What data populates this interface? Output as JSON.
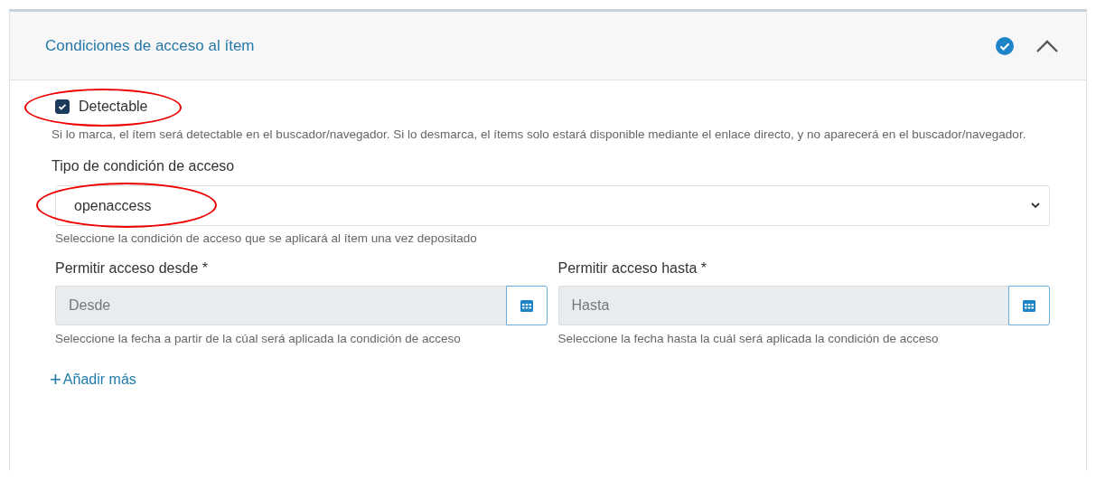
{
  "panel": {
    "title": "Condiciones de acceso al ítem",
    "completed": true,
    "expanded": true
  },
  "detectable": {
    "label": "Detectable",
    "checked": true,
    "highlighted": true,
    "help": "Si lo marca, el ítem será detectable en el buscador/navegador. Si lo desmarca, el ítems solo estará disponible mediante el enlace directo, y no aparecerá en el buscador/navegador."
  },
  "access_type": {
    "label": "Tipo de condición de acceso",
    "value": "openaccess",
    "highlighted": true,
    "help": "Seleccione la condición de acceso que se aplicará al ítem una vez depositado"
  },
  "dates": [
    {
      "label": "Permitir acceso desde *",
      "placeholder": "Desde",
      "help": "Seleccione la fecha a partir de la cúal será aplicada la condición de acceso"
    },
    {
      "label": "Permitir acceso hasta *",
      "placeholder": "Hasta",
      "help": "Seleccione la fecha hasta la cuál será aplicada la condición de acceso"
    }
  ],
  "add_more": {
    "icon": "+",
    "label": "Añadir más"
  }
}
